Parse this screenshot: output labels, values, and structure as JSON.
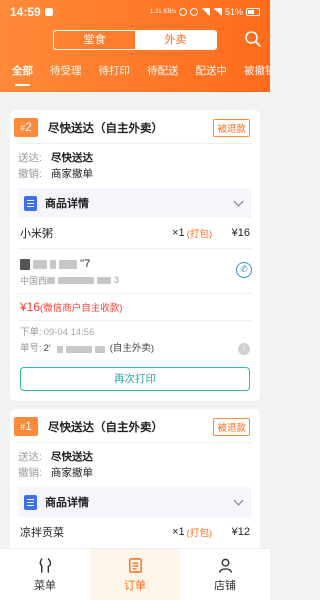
{
  "status_bar": {
    "time": "14:59",
    "network": "1.21 KB/s",
    "battery": "51%"
  },
  "header": {
    "segments": [
      {
        "label": "堂食",
        "active": false
      },
      {
        "label": "外卖",
        "active": true
      }
    ],
    "tabs": [
      "全部",
      "待受理",
      "待打印",
      "待配送",
      "配送中",
      "被撤销"
    ],
    "active_tab": 0
  },
  "orders": [
    {
      "num_prefix": "#",
      "num": "2",
      "title": "尽快送达（自主外卖）",
      "badge": "被退款",
      "deliver_label": "送达:",
      "deliver_value": "尽快送达",
      "cancel_label": "撤销:",
      "cancel_value": "商家撤单",
      "details_title": "商品详情",
      "item": {
        "name": "小米粥",
        "qty": "×1",
        "pack": "(打包)",
        "price": "¥16"
      },
      "customer_name_suffix": "''7",
      "customer_addr_prefix": "中国西",
      "customer_addr_suffix": "3",
      "pay_amount": "¥16",
      "pay_note": "(微信商户自主收款)",
      "order_time_label": "下单:",
      "order_time": "09-04 14:56",
      "order_no_label": "单号:",
      "order_no_prefix": "2'",
      "order_no_source": "(自主外卖)",
      "reprint_label": "再次打印"
    },
    {
      "num_prefix": "#",
      "num": "1",
      "title": "尽快送达（自主外卖）",
      "badge": "被退款",
      "deliver_label": "送达:",
      "deliver_value": "尽快送达",
      "cancel_label": "撤销:",
      "cancel_value": "商家撤单",
      "details_title": "商品详情",
      "item": {
        "name": "凉拌贡菜",
        "qty": "×1",
        "pack": "(打包)",
        "price": "¥12"
      }
    }
  ],
  "bottom_nav": [
    {
      "label": "菜单",
      "icon": "menu-icon",
      "active": false
    },
    {
      "label": "订单",
      "icon": "order-icon",
      "active": true
    },
    {
      "label": "店铺",
      "icon": "store-icon",
      "active": false
    }
  ],
  "colors": {
    "accent": "#ff6b1a",
    "teal": "#2aa79f",
    "price_red": "#ff3b30",
    "blue": "#3b6ff0"
  }
}
